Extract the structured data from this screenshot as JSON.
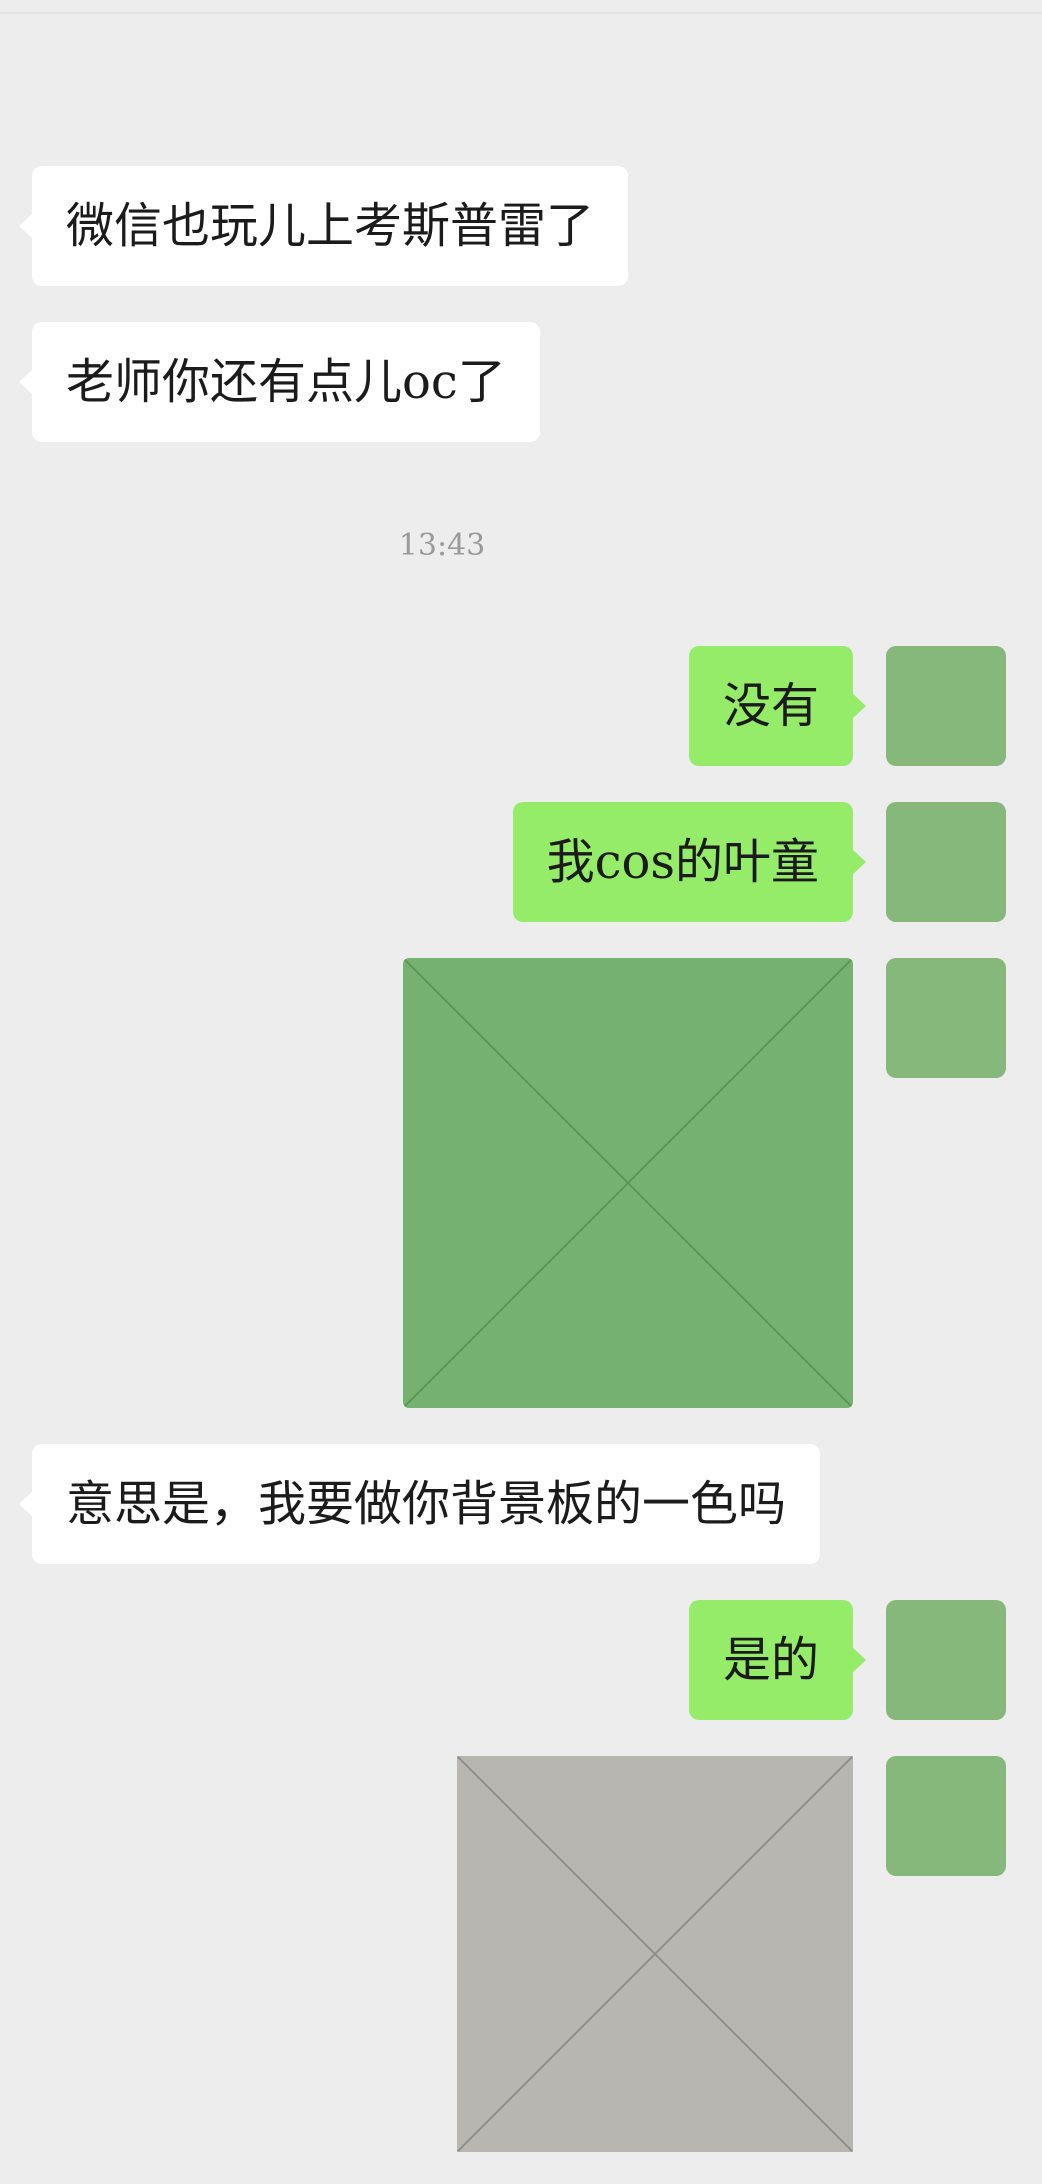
{
  "chat": {
    "messages": [
      {
        "side": "left",
        "text": "微信也玩儿上考斯普雷了"
      },
      {
        "side": "left",
        "text": "老师你还有点儿oc了"
      },
      {
        "side": "right",
        "text": "没有"
      },
      {
        "side": "right",
        "text": "我cos的叶童"
      },
      {
        "side": "left",
        "text": "意思是，我要做你背景板的一色吗"
      },
      {
        "side": "right",
        "text": "是的"
      }
    ],
    "timestamp": "13:43"
  },
  "colors": {
    "background": "#ededed",
    "bubble_left": "#ffffff",
    "bubble_right": "#95ec69",
    "avatar": "#86b77b"
  }
}
